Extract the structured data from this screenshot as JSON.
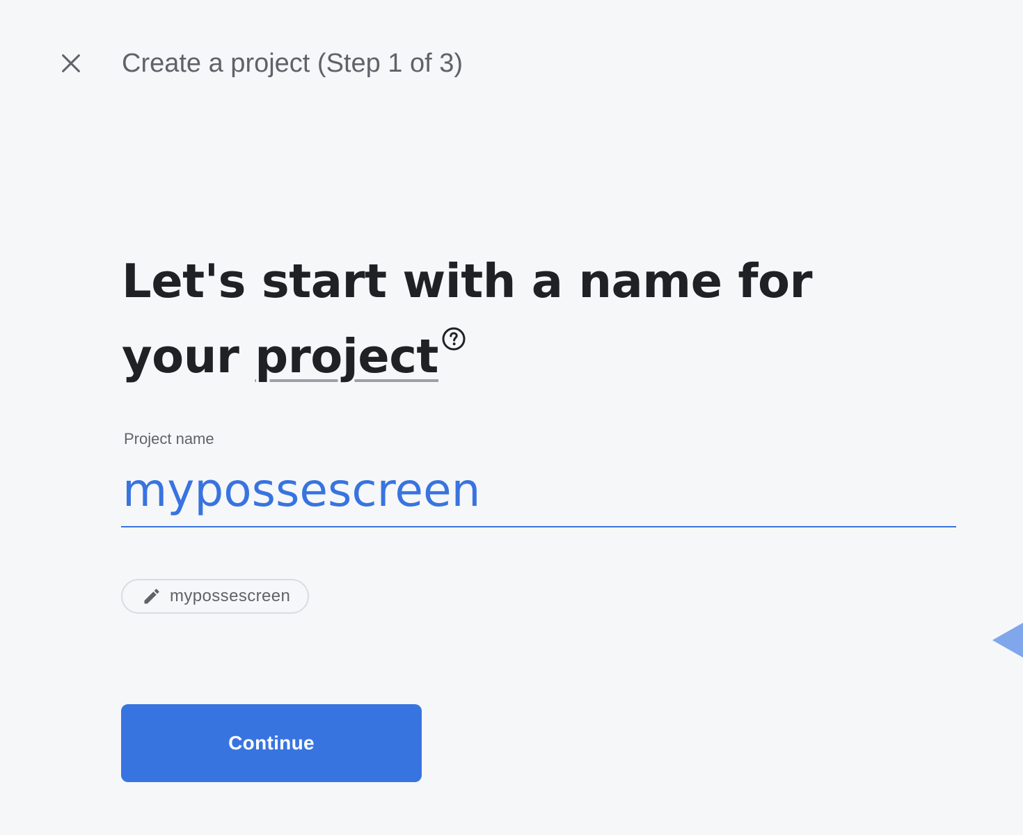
{
  "header": {
    "title": "Create a project (Step 1 of 3)",
    "close_icon": "close-icon"
  },
  "heading": {
    "line1": "Let's start with a name for",
    "line2_prefix": "your ",
    "line2_link": "project",
    "help_icon": "help-circle-icon"
  },
  "project_name_field": {
    "label": "Project name",
    "value": "mypossescreen"
  },
  "project_id_chip": {
    "icon": "pencil-icon",
    "label": "mypossescreen"
  },
  "continue_button": {
    "label": "Continue"
  },
  "colors": {
    "accent": "#3874e0",
    "background": "#f6f7f9",
    "text_primary": "#202124",
    "text_secondary": "#5f6368"
  }
}
